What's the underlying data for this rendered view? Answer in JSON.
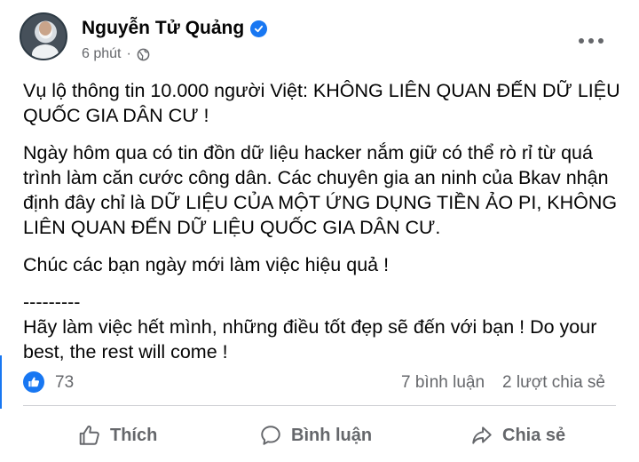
{
  "post": {
    "author": "Nguyễn Tử Quảng",
    "time": "6 phút",
    "time_separator": "·",
    "paragraphs": [
      "Vụ lộ thông tin 10.000 người Việt: KHÔNG LIÊN QUAN ĐẾN DỮ LIỆU\nQUỐC GIA DÂN CƯ !",
      "Ngày hôm qua có tin đồn dữ liệu hacker nắm giữ có thể rò rỉ từ quá\ntrình làm căn cước công dân. Các chuyên gia an ninh của Bkav nhận\nđịnh đây chỉ là DỮ LIỆU CỦA MỘT ỨNG DỤNG TIỀN ẢO PI, KHÔNG\nLIÊN QUAN ĐẾN DỮ LIỆU QUỐC GIA DÂN CƯ.",
      "Chúc các bạn ngày mới làm việc hiệu quả !",
      "---------\nHãy làm việc hết mình, những điều tốt đẹp sẽ đến với bạn ! Do your\nbest, the rest will come !"
    ]
  },
  "stats": {
    "likes": "73",
    "comments": "7 bình luận",
    "shares": "2 lượt chia sẻ"
  },
  "actions": {
    "like_label": "Thích",
    "comment_label": "Bình luận",
    "share_label": "Chia sẻ"
  },
  "colors": {
    "accent": "#1877f2",
    "secondary_text": "#65676b",
    "divider": "#ced0d4"
  },
  "icons": [
    "verified-icon",
    "globe-icon",
    "more-icon",
    "like-reaction-icon",
    "thumbs-up-icon",
    "comment-icon",
    "share-icon"
  ]
}
